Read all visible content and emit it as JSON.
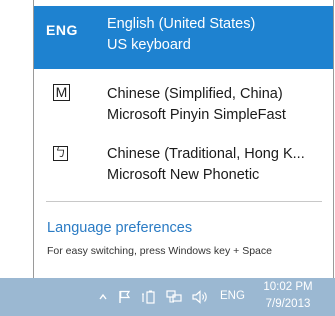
{
  "input_switcher": {
    "items": [
      {
        "code": "ENG",
        "language": "English (United States)",
        "keyboard": "US keyboard",
        "selected": true
      },
      {
        "icon_glyph": "M",
        "icon": "microsoft-pinyin-mode-icon",
        "language": "Chinese (Simplified, China)",
        "keyboard": "Microsoft Pinyin SimpleFast"
      },
      {
        "icon_glyph": "ㄅ",
        "icon": "new-phonetic-mode-icon",
        "language": "Chinese (Traditional, Hong K...",
        "keyboard": "Microsoft New Phonetic"
      }
    ],
    "preferences_link": "Language preferences",
    "hint": "For easy switching, press Windows key + Space"
  },
  "taskbar": {
    "lang": "ENG",
    "time": "10:02 PM",
    "date": "7/9/2013",
    "tray_icons": [
      "show-hidden-icons-chevron",
      "action-center-flag-icon",
      "power-icon",
      "network-icon",
      "volume-icon"
    ]
  },
  "colors": {
    "selected_bg": "#1e82d0",
    "link": "#2a7bc4",
    "taskbar_bg": "#9bb8d2"
  }
}
